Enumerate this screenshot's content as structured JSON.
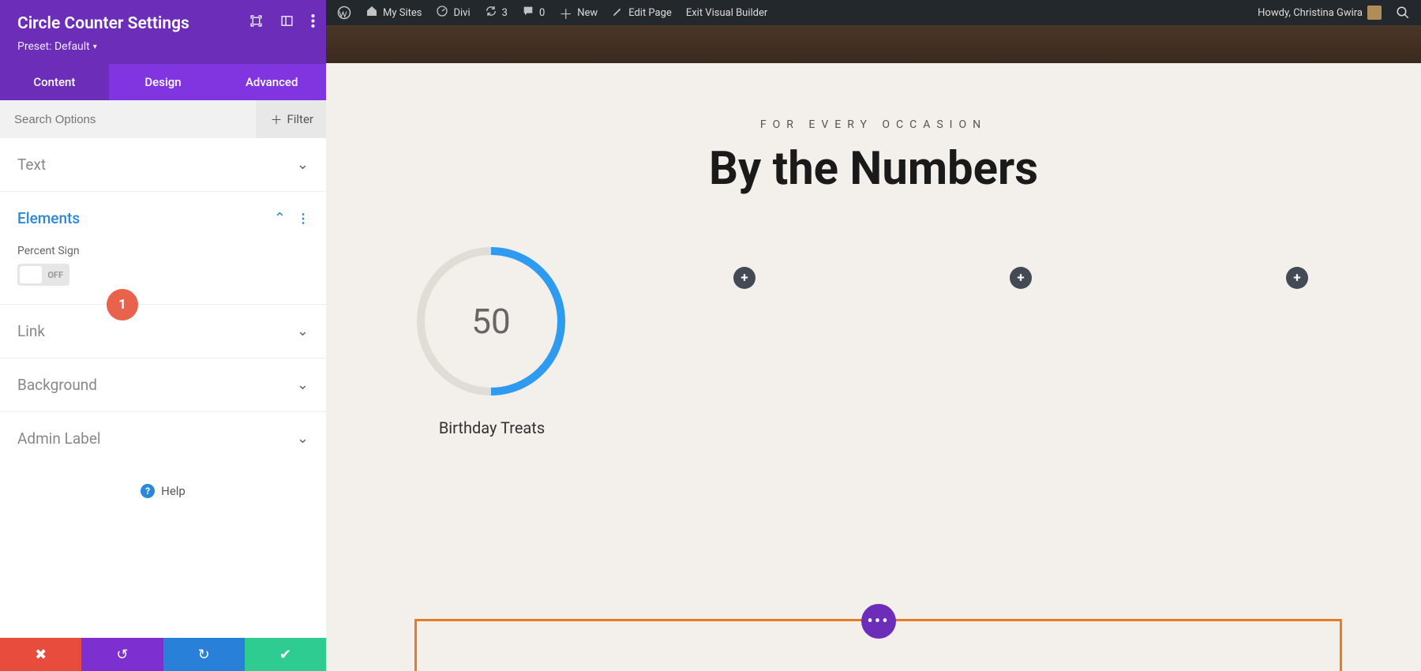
{
  "sidebar": {
    "title": "Circle Counter Settings",
    "preset_label": "Preset: Default",
    "tabs": [
      {
        "label": "Content",
        "active": true
      },
      {
        "label": "Design",
        "active": false
      },
      {
        "label": "Advanced",
        "active": false
      }
    ],
    "search_placeholder": "Search Options",
    "filter_label": "Filter",
    "sections": {
      "text": {
        "label": "Text"
      },
      "elements": {
        "label": "Elements"
      },
      "link": {
        "label": "Link"
      },
      "background": {
        "label": "Background"
      },
      "admin": {
        "label": "Admin Label"
      }
    },
    "elements_panel": {
      "percent_sign_label": "Percent Sign",
      "toggle_state": "OFF"
    },
    "help_label": "Help"
  },
  "annotation": {
    "num": "1"
  },
  "adminbar": {
    "my_sites": "My Sites",
    "divi": "Divi",
    "updates": "3",
    "comments": "0",
    "new": "New",
    "edit_page": "Edit Page",
    "exit_vb": "Exit Visual Builder",
    "howdy": "Howdy, Christina Gwira"
  },
  "hero": {
    "eyebrow": "FOR EVERY OCCASION",
    "title": "By the Numbers"
  },
  "counter": {
    "value": "50",
    "percent": 50,
    "caption": "Birthday Treats",
    "ring_color": "#2e9bf0",
    "track_color": "#e0dcd6"
  },
  "module_fab": "•••",
  "quote_glyph": "“"
}
